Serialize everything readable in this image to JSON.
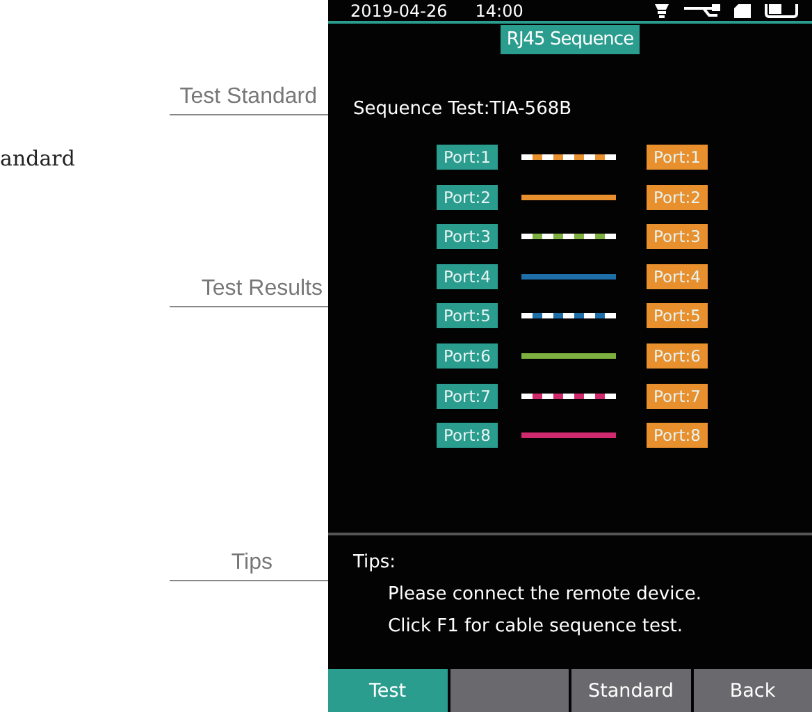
{
  "annotations": [
    {
      "label": "Test Standard"
    },
    {
      "label": "Test Results"
    },
    {
      "label": "Tips"
    }
  ],
  "cut_heading": "andard",
  "status_bar": {
    "date": "2019-04-26",
    "time": "14:00"
  },
  "screen_title": "RJ45 Sequence",
  "sequence_test": "Sequence Test:TIA-568B",
  "rows": [
    {
      "near": "Port:1",
      "far": "Port:1",
      "color": "#e8902e",
      "striped": true
    },
    {
      "near": "Port:2",
      "far": "Port:2",
      "color": "#e8902e",
      "striped": false
    },
    {
      "near": "Port:3",
      "far": "Port:3",
      "color": "#7db040",
      "striped": true
    },
    {
      "near": "Port:4",
      "far": "Port:4",
      "color": "#1e6fa8",
      "striped": false
    },
    {
      "near": "Port:5",
      "far": "Port:5",
      "color": "#1e6fa8",
      "striped": true
    },
    {
      "near": "Port:6",
      "far": "Port:6",
      "color": "#7db040",
      "striped": false
    },
    {
      "near": "Port:7",
      "far": "Port:7",
      "color": "#d02a6e",
      "striped": true
    },
    {
      "near": "Port:8",
      "far": "Port:8",
      "color": "#d02a6e",
      "striped": false
    }
  ],
  "tips": {
    "heading": "Tips:",
    "lines": [
      "Please connect the remote device.",
      "Click F1 for cable sequence test."
    ]
  },
  "softkeys": [
    {
      "label": "Test",
      "selected": true
    },
    {
      "selected": false
    },
    {
      "label": "Standard",
      "selected": false
    },
    {
      "label": "Back",
      "selected": false
    }
  ]
}
